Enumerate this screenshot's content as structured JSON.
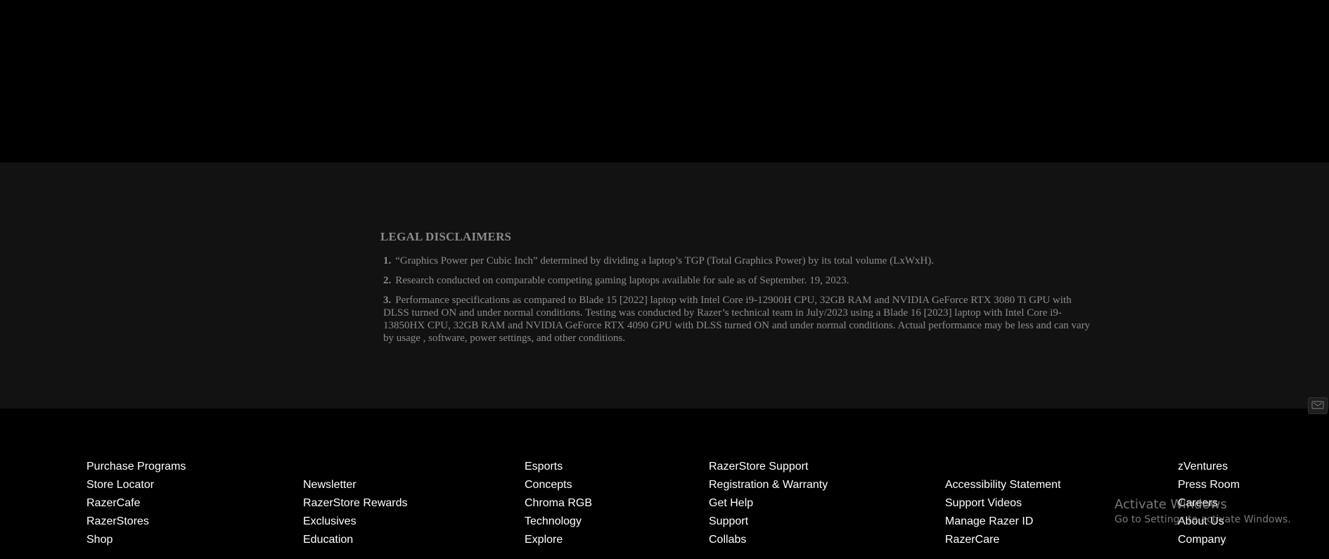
{
  "legal": {
    "title": "LEGAL DISCLAIMERS",
    "items": [
      {
        "num": "1.",
        "text": "“Graphics Power per Cubic Inch” determined by dividing a laptop’s TGP (Total Graphics Power) by its total volume (LxWxH)."
      },
      {
        "num": "2.",
        "text": "Research conducted on comparable competing gaming laptops available for sale as of September. 19, 2023."
      },
      {
        "num": "3.",
        "text": "Performance specifications as compared to Blade 15 [2022] laptop with Intel Core i9-12900H CPU, 32GB RAM and NVIDIA GeForce RTX 3080 Ti GPU with DLSS turned ON and under normal conditions. Testing was conducted by Razer’s technical team in July/2023 using a Blade 16 [2023] laptop with Intel Core i9-13850HX CPU, 32GB RAM and NVIDIA GeForce RTX 4090 GPU with DLSS turned ON and under normal conditions. Actual performance may be less and can vary by usage , software, power settings, and other conditions."
      }
    ]
  },
  "footer": {
    "col1": [
      "Purchase Programs",
      "Store Locator",
      "RazerCafe",
      "RazerStores",
      "Shop"
    ],
    "col2": [
      "Newsletter",
      "RazerStore Rewards",
      "Exclusives",
      "Education"
    ],
    "col3": [
      "Esports",
      "Concepts",
      "Chroma RGB",
      "Technology",
      "Explore"
    ],
    "col4": [
      "RazerStore Support",
      "Registration & Warranty",
      "Get Help",
      "Support",
      "Collabs"
    ],
    "col5": [
      "Accessibility Statement",
      "Support Videos",
      "Manage Razer ID",
      "RazerCare"
    ],
    "col6": [
      "zVentures",
      "Press Room",
      "Careers",
      "About Us",
      "Company"
    ]
  },
  "chat_widget": {
    "icon": "chat-icon"
  },
  "windows_watermark": {
    "title": "Activate Windows",
    "subtitle": "Go to Settings to activate Windows."
  },
  "colors": {
    "page_background": "#000000",
    "legal_background": "#121212",
    "legal_text": "#8c8c8c",
    "footer_link": "#ffffff"
  }
}
